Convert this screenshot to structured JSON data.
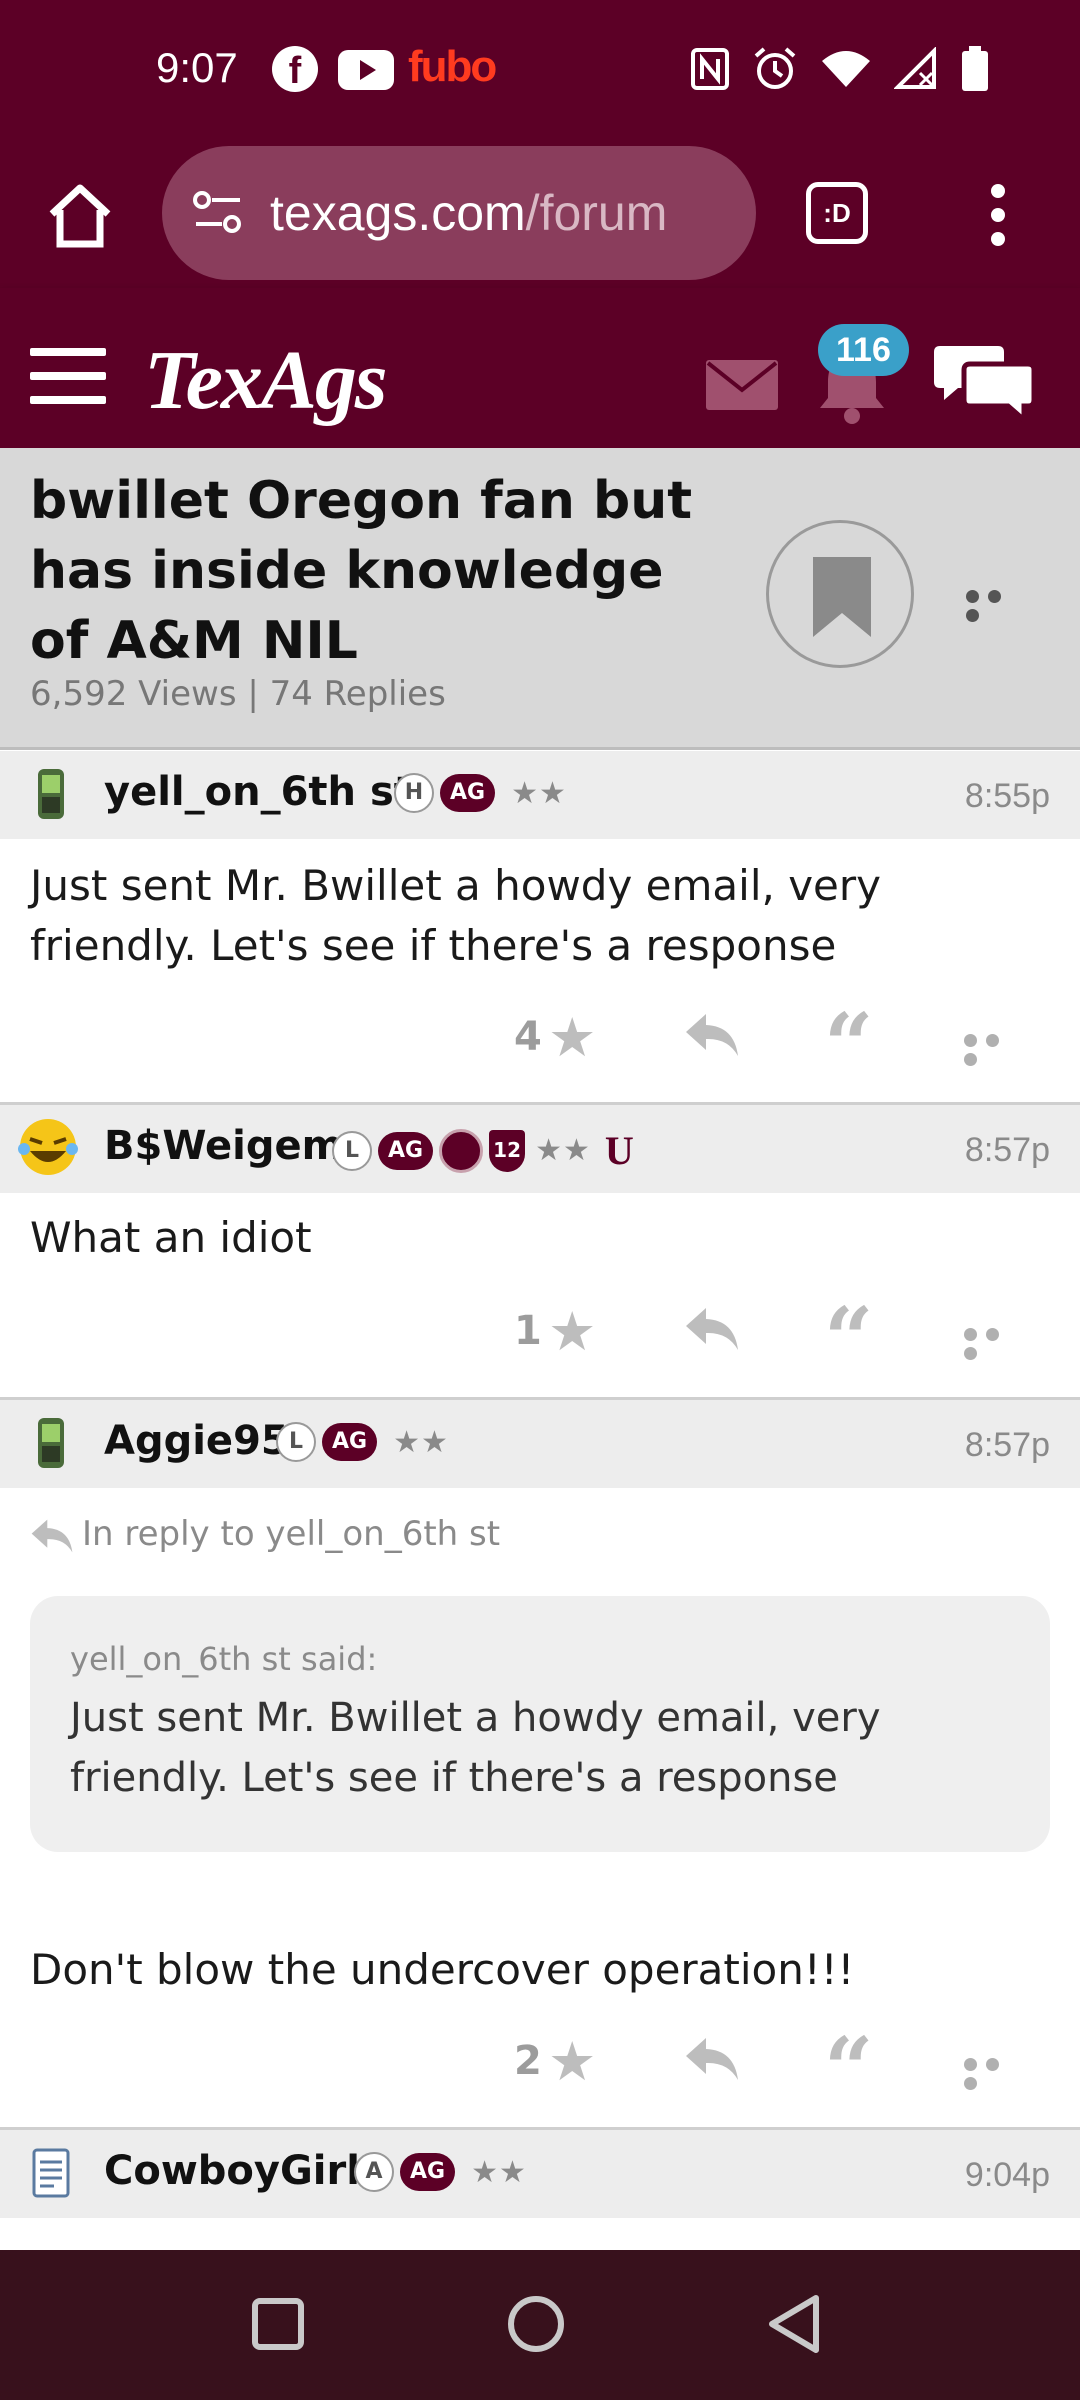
{
  "status_bar": {
    "time": "9:07",
    "app_icons": [
      "facebook-icon",
      "youtube-icon",
      "fubo-icon"
    ],
    "fubo_label": "fubo",
    "system_icons": [
      "nfc-icon",
      "alarm-icon",
      "wifi-icon",
      "signal-icon",
      "battery-icon"
    ]
  },
  "browser": {
    "url_host": "texags.com",
    "url_path": "/forum",
    "tabs_label": ":D"
  },
  "site_header": {
    "logo": "TexAgs",
    "notification_count": "116"
  },
  "thread": {
    "title": "bwillet Oregon fan but has inside knowledge of A&M NIL",
    "stats": "6,592 Views | 74 Replies"
  },
  "posts": [
    {
      "username": "yell_on_6th st",
      "time": "8:55p",
      "badges": [
        "H",
        "AG"
      ],
      "stars": "★★",
      "body": "Just sent Mr. Bwillet a howdy email, very friendly. Let's see if there's a response",
      "star_count": "4"
    },
    {
      "username": "B$Weigem",
      "time": "8:57p",
      "badges": [
        "L",
        "AG",
        "12"
      ],
      "stars": "★★",
      "extra_badge": "U",
      "body": "What an idiot",
      "star_count": "1"
    },
    {
      "username": "Aggie95",
      "time": "8:57p",
      "badges": [
        "L",
        "AG"
      ],
      "stars": "★★",
      "reply_to": "In reply to yell_on_6th st",
      "quote_author": "yell_on_6th st said:",
      "quote_text": "Just sent Mr. Bwillet a howdy email, very friendly. Let's see if there's a response",
      "body": "Don't blow the undercover operation!!!",
      "star_count": "2"
    },
    {
      "username": "CowboyGirl",
      "time": "9:04p",
      "badges": [
        "A",
        "AG"
      ],
      "stars": "★★"
    }
  ],
  "colors": {
    "brand_maroon": "#5c0026",
    "badge_blue": "#3aa0c9",
    "nav_bar": "#38111c"
  }
}
